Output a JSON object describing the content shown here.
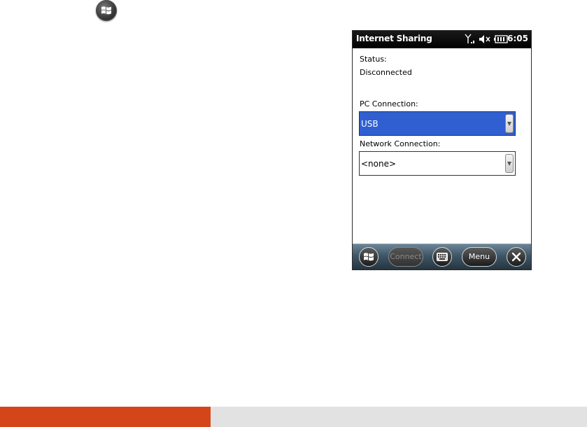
{
  "window": {
    "title": "Internet Sharing",
    "clock": "6:05"
  },
  "status": {
    "label": "Status:",
    "value": "Disconnected"
  },
  "pc_connection": {
    "label": "PC Connection:",
    "selected": "USB"
  },
  "network_connection": {
    "label": "Network Connection:",
    "selected": "<none>"
  },
  "softkeys": {
    "connect": "Connect",
    "menu": "Menu"
  },
  "icons": [
    "windows-logo-icon",
    "signal-antenna-icon",
    "speaker-muted-icon",
    "battery-icon",
    "keyboard-icon",
    "close-icon"
  ],
  "colors": {
    "accent_orange": "#d4461a",
    "selection_blue": "#2f5fd0",
    "title_bar": "#000000"
  }
}
